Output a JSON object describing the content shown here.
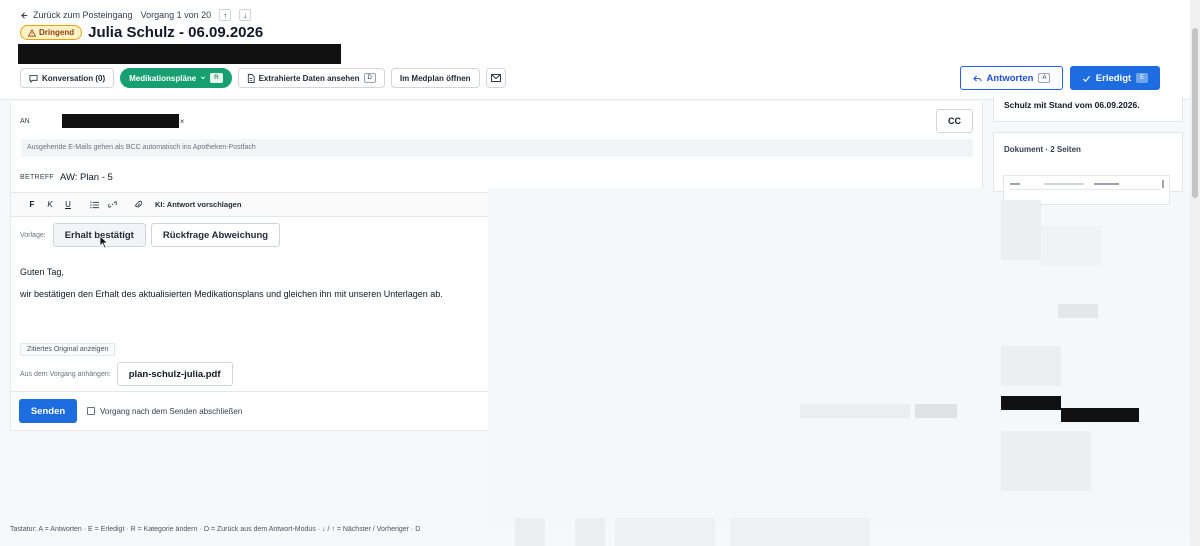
{
  "header": {
    "back_label": "Zurück zum Posteingang",
    "counter": "Vorgang 1 von 20",
    "up_arrow": "↑",
    "down_arrow": "↓",
    "badge": "Dringend",
    "title": "Julia Schulz - 06.09.2026"
  },
  "actions": {
    "conversation": "Konversation (0)",
    "medplans": "Medikationspläne",
    "medplans_key": "R",
    "extract": "Extrahierte Daten ansehen",
    "extract_key": "D",
    "open_medplan": "Im Medplan öffnen",
    "reply": "Antworten",
    "reply_key": "A",
    "done": "Erledigt",
    "done_key": "E"
  },
  "compose": {
    "to_label": "AN",
    "remove_x": "×",
    "cc": "CC",
    "bcc_note": "Ausgehende E-Mails gehen als BCC automatisch ins Apotheken-Postfach",
    "subject_label": "BETREFF",
    "subject": "AW: Plan - 5",
    "toolbar": {
      "bold": "F",
      "italic": "K",
      "underline": "U",
      "ai": "KI: Antwort vorschlagen"
    },
    "template_label": "Vorlage:",
    "templates": [
      "Erhalt bestätigt",
      "Rückfrage Abweichung"
    ],
    "greeting": "Guten Tag,",
    "body": "wir bestätigen den Erhalt des aktualisierten Medikationsplans und gleichen ihn mit unseren Unterlagen ab.",
    "show_quoted": "Zitiertes Original anzeigen",
    "attach_label": "Aus dem Vorgang anhängen:",
    "attachment": "plan-schulz-julia.pdf",
    "send": "Senden",
    "close_after_send": "Vorgang nach dem Senden abschließen"
  },
  "sidebar": {
    "summary_tail": "Schulz mit Stand vom 06.09.2026.",
    "doc_title": "Dokument · 2 Seiten"
  },
  "footer": {
    "shortcuts": "Tastatur: A = Antworten · E = Erledigt · R = Kategorie ändern · O = Zurück aus dem Antwort-Modus · ↓ / ↑ = Nächster / Vorheriger · D"
  },
  "colors": {
    "primary": "#1d6ce0",
    "active_green": "#16a072",
    "urgent_bg": "#fef3c7"
  }
}
